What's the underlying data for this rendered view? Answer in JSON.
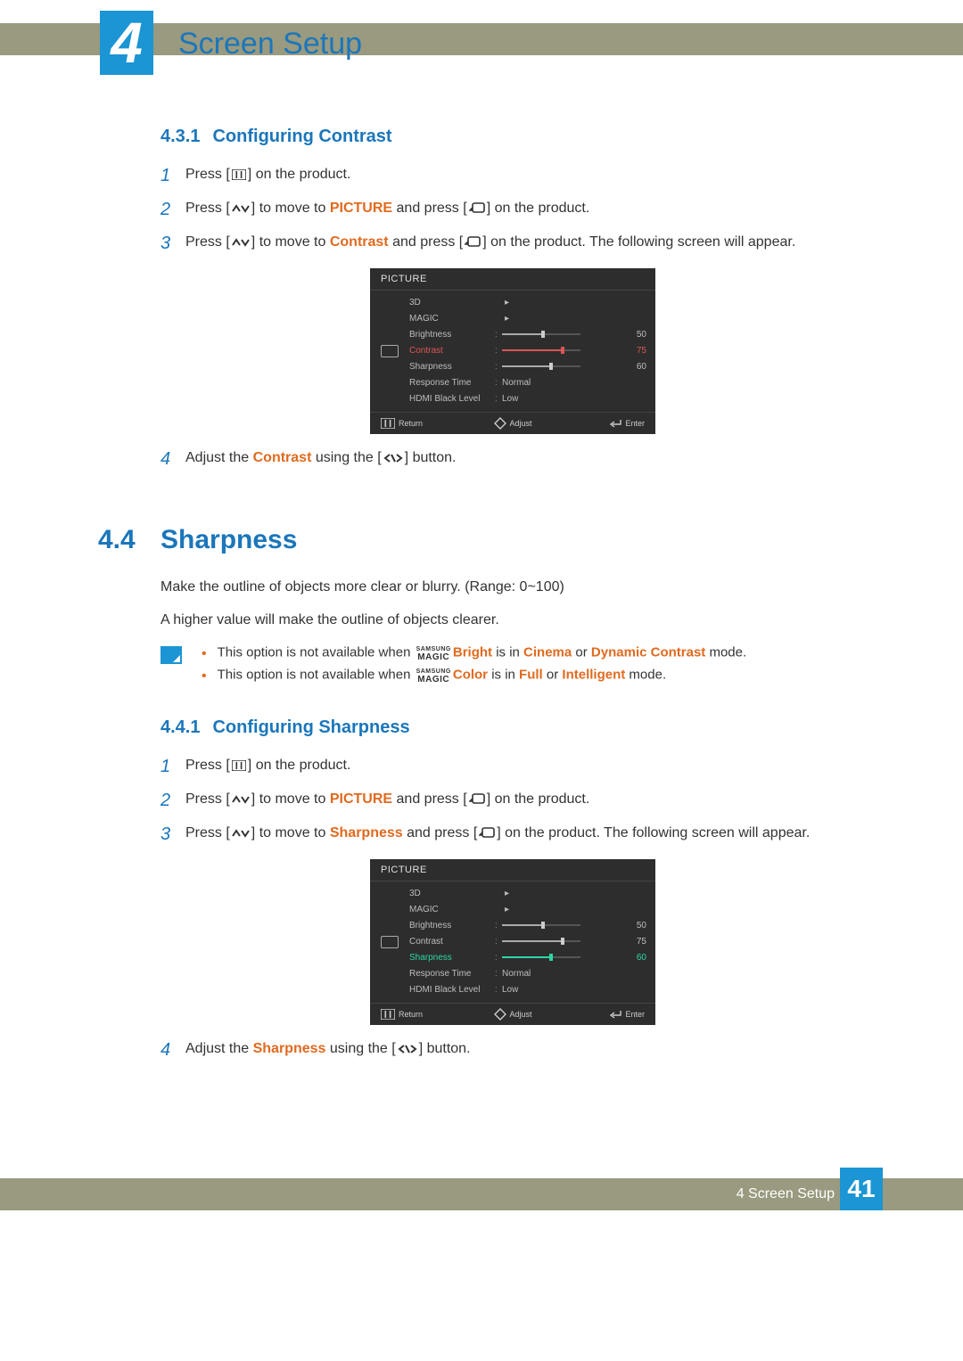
{
  "header": {
    "chapter_number": "4",
    "chapter_title": "Screen Setup"
  },
  "sec431": {
    "number": "4.3.1",
    "title": "Configuring Contrast",
    "steps": {
      "s1a": "Press [",
      "s1b": "] on the product.",
      "s2a": "Press [",
      "s2b": "] to move to ",
      "s2c": "PICTURE",
      "s2d": " and press [",
      "s2e": "] on the product.",
      "s3a": "Press [",
      "s3b": "] to move to ",
      "s3c": "Contrast",
      "s3d": " and press [",
      "s3e": "] on the product. The following screen will appear.",
      "s4a": "Adjust the ",
      "s4b": "Contrast",
      "s4c": " using the [",
      "s4d": "] button."
    }
  },
  "osd1": {
    "title": "PICTURE",
    "rows": {
      "threeD": "3D",
      "magic": "MAGIC",
      "brightness": "Brightness",
      "contrast": "Contrast",
      "sharpness": "Sharpness",
      "response": "Response Time",
      "hdmi": "HDMI Black Level"
    },
    "values": {
      "brightness": "50",
      "contrast": "75",
      "sharpness": "60",
      "response": "Normal",
      "hdmi": "Low"
    },
    "footer": {
      "return": "Return",
      "adjust": "Adjust",
      "enter": "Enter"
    }
  },
  "sec44": {
    "number": "4.4",
    "title": "Sharpness",
    "p1": "Make the outline of objects more clear or blurry. (Range: 0~100)",
    "p2": "A higher value will make the outline of objects clearer.",
    "note1": {
      "a": "This option is not available when ",
      "b": "Bright",
      "c": " is in ",
      "d": "Cinema",
      "e": " or ",
      "f": "Dynamic Contrast",
      "g": " mode."
    },
    "note2": {
      "a": "This option is not available when ",
      "b": "Color",
      "c": " is in ",
      "d": "Full",
      "e": " or ",
      "f": "Intelligent",
      "g": " mode."
    },
    "magic": {
      "top": "SAMSUNG",
      "bot": "MAGIC"
    }
  },
  "sec441": {
    "number": "4.4.1",
    "title": "Configuring Sharpness",
    "steps": {
      "s1a": "Press [",
      "s1b": "] on the product.",
      "s2a": "Press [",
      "s2b": "] to move to ",
      "s2c": "PICTURE",
      "s2d": " and press [",
      "s2e": "] on the product.",
      "s3a": "Press [",
      "s3b": "] to move to ",
      "s3c": "Sharpness",
      "s3d": " and press [",
      "s3e": "] on the product. The following screen will appear.",
      "s4a": "Adjust the ",
      "s4b": "Sharpness",
      "s4c": " using the [",
      "s4d": "] button."
    }
  },
  "osd2": {
    "title": "PICTURE",
    "values": {
      "brightness": "50",
      "contrast": "75",
      "sharpness": "60",
      "response": "Normal",
      "hdmi": "Low"
    }
  },
  "footer": {
    "text": "4 Screen Setup",
    "page": "41"
  }
}
